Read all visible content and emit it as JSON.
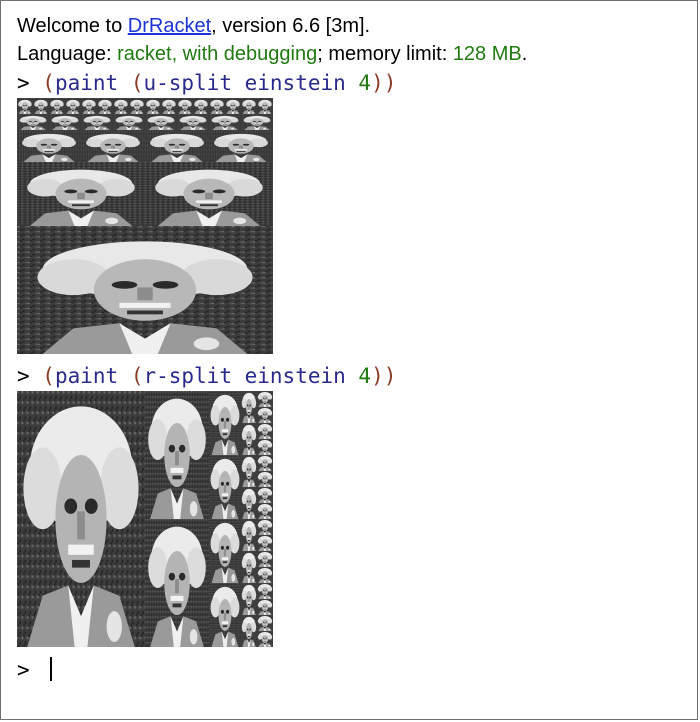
{
  "banner": {
    "welcome_prefix": "Welcome to ",
    "app_link": "DrRacket",
    "version_text": ", version 6.6 [3m].",
    "language_label": "Language: ",
    "language_value": "racket, with debugging",
    "memory_label": "; memory limit: ",
    "memory_value": "128 MB",
    "memory_suffix": "."
  },
  "interactions": [
    {
      "prompt": "> ",
      "open_outer": "(",
      "fn": "paint",
      "open_inner": " (",
      "inner_fn": "u-split",
      "arg": " einstein ",
      "number": "4",
      "close": "))",
      "output_image": "u-split einstein portrait"
    },
    {
      "prompt": "> ",
      "open_outer": "(",
      "fn": "paint",
      "open_inner": " (",
      "inner_fn": "r-split",
      "arg": " einstein ",
      "number": "4",
      "close": "))",
      "output_image": "r-split einstein portrait"
    }
  ],
  "current_prompt": "> ",
  "colors": {
    "link": "#1a34d6",
    "green": "#1f7a10",
    "paren": "#8b3a24",
    "symbol": "#2a2a8c"
  }
}
